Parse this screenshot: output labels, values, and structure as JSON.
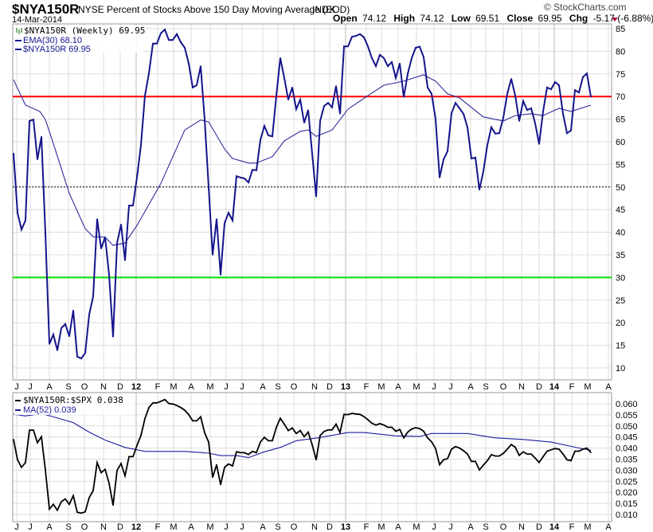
{
  "header": {
    "symbol": "$NYA150R",
    "description": "NYSE Percent of Stocks Above 150 Day Moving Average (EOD)",
    "exchange": "INDX",
    "date": "14-Mar-2014",
    "copyright": "© StockCharts.com",
    "open_label": "Open",
    "open": "74.12",
    "high_label": "High",
    "high": "74.12",
    "low_label": "Low",
    "low": "69.51",
    "close_label": "Close",
    "close": "69.95",
    "chg_label": "Chg",
    "chg": "-5.17 (-6.88%)",
    "chg_icon": "down-triangle-icon"
  },
  "colors": {
    "price": "#14148c",
    "ema": "#2b2b9a",
    "up": "#006400",
    "down": "#dc143c",
    "red_line": "#ff0000",
    "green_line": "#00e000",
    "ratio": "#000000",
    "ma": "#1c1ca0",
    "grid": "#dcdcdc"
  },
  "chart_data": [
    {
      "type": "line",
      "title": "$NYA150R (Weekly) 69.95",
      "x_unit": "week index (0 = mid-Jun 2011, 145 = 14-Mar-2014)",
      "ylim": [
        7.4,
        86
      ],
      "yticks": [
        "85",
        "80",
        "75",
        "70",
        "65",
        "60",
        "55",
        "50",
        "45",
        "40",
        "35",
        "30",
        "25",
        "20",
        "15",
        "10"
      ],
      "legend": [
        "$NYA150R (Weekly) 69.95",
        "EMA(30) 68.10",
        "$NYA150R 69.95"
      ],
      "reference_lines": [
        {
          "value": 70,
          "style": "red"
        },
        {
          "value": 50,
          "style": "dotted"
        },
        {
          "value": 30,
          "style": "green"
        }
      ],
      "series": [
        {
          "name": "$NYA150R",
          "values": [
            57.4,
            44.3,
            40.6,
            42.6,
            64.6,
            64.9,
            56.1,
            61.1,
            39.8,
            15.3,
            17.4,
            13.9,
            18.8,
            19.7,
            17.0,
            22.7,
            12.5,
            12.1,
            13.3,
            21.8,
            25.8,
            42.9,
            36.4,
            38.9,
            30.6,
            16.9,
            37.6,
            41.7,
            33.8,
            45.9,
            45.9,
            52.1,
            59.3,
            70.2,
            75.1,
            81.7,
            81.7,
            84.0,
            84.8,
            82.5,
            82.5,
            83.8,
            82.0,
            80.8,
            77.3,
            72.0,
            72.5,
            76.7,
            64.9,
            50,
            35.0,
            42.9,
            30.6,
            42.0,
            44.3,
            42.6,
            52.4,
            52.1,
            51.9,
            51.0,
            53.8,
            53.7,
            60.4,
            63.5,
            61.4,
            61.2,
            70.2,
            78.5,
            74.1,
            69.3,
            72.0,
            67.2,
            69.3,
            64.2,
            67.0,
            57.4,
            47.9,
            64.6,
            67.9,
            68.6,
            67.6,
            72.3,
            66.2,
            81.1,
            81.1,
            83.2,
            83.4,
            83.8,
            83.1,
            81.1,
            78.5,
            76.7,
            79.2,
            78.5,
            76.7,
            77.6,
            74.1,
            77.3,
            69.9,
            75.0,
            78.5,
            80.8,
            81.0,
            78.7,
            72.0,
            70.6,
            65.0,
            52.1,
            56.1,
            57.9,
            66.3,
            68.6,
            67.4,
            66.2,
            63.2,
            56.3,
            56.5,
            49.4,
            53.5,
            59.3,
            63.2,
            61.8,
            61.9,
            65.3,
            70.6,
            73.9,
            70.2,
            64.6,
            69.0,
            67.0,
            67.4,
            64.1,
            59.5,
            66.7,
            72.0,
            71.6,
            73.2,
            72.5,
            66.2,
            61.9,
            62.5,
            71.4,
            70.9,
            74.3,
            75.1,
            69.95
          ]
        },
        {
          "name": "EMA(30)",
          "points": [
            [
              0,
              73.7
            ],
            [
              3,
              68.1
            ],
            [
              6.6,
              66.7
            ],
            [
              8,
              64.9
            ],
            [
              10,
              59.6
            ],
            [
              14,
              48.6
            ],
            [
              18,
              40.8
            ],
            [
              20,
              39.0
            ],
            [
              23,
              38.9
            ],
            [
              25,
              37.1
            ],
            [
              28,
              37.6
            ],
            [
              31,
              41.5
            ],
            [
              37,
              50.8
            ],
            [
              43,
              62.6
            ],
            [
              47,
              64.8
            ],
            [
              49,
              64.4
            ],
            [
              53,
              58.4
            ],
            [
              55,
              56.3
            ],
            [
              59,
              55.3
            ],
            [
              61,
              55.3
            ],
            [
              65,
              56.7
            ],
            [
              68,
              60.2
            ],
            [
              72,
              62.3
            ],
            [
              74,
              62.6
            ],
            [
              76,
              61.2
            ],
            [
              80,
              62.6
            ],
            [
              84,
              67.2
            ],
            [
              89,
              70.2
            ],
            [
              93,
              72.5
            ],
            [
              98,
              73.4
            ],
            [
              103,
              74.8
            ],
            [
              106,
              73.4
            ],
            [
              109,
              70.6
            ],
            [
              112,
              69.7
            ],
            [
              118,
              65.5
            ],
            [
              123,
              64.6
            ],
            [
              126,
              65.8
            ],
            [
              130,
              66.2
            ],
            [
              133,
              65.8
            ],
            [
              137,
              67.4
            ],
            [
              140,
              66.7
            ],
            [
              145,
              68.1
            ]
          ]
        }
      ]
    },
    {
      "type": "line",
      "title": "$NYA150R:$SPX 0.038",
      "ylim": [
        0.0068,
        0.065
      ],
      "yticks": [
        "0.060",
        "0.055",
        "0.050",
        "0.045",
        "0.040",
        "0.035",
        "0.030",
        "0.025",
        "0.020",
        "0.015",
        "0.010"
      ],
      "legend": [
        "$NYA150R:$SPX 0.038",
        "MA(52) 0.039"
      ],
      "series": [
        {
          "name": "$NYA150R:$SPX",
          "values": [
            0.0439,
            0.0347,
            0.0313,
            0.0334,
            0.0481,
            0.0481,
            0.0424,
            0.0451,
            0.0301,
            0.0124,
            0.0146,
            0.0119,
            0.0158,
            0.017,
            0.0146,
            0.0185,
            0.011,
            0.0106,
            0.0112,
            0.0176,
            0.0208,
            0.0334,
            0.0289,
            0.0304,
            0.0241,
            0.0142,
            0.0299,
            0.033,
            0.0275,
            0.0361,
            0.0361,
            0.0412,
            0.0457,
            0.0533,
            0.0583,
            0.0604,
            0.0604,
            0.0611,
            0.0619,
            0.0601,
            0.0599,
            0.0592,
            0.0583,
            0.0571,
            0.0551,
            0.0523,
            0.0523,
            0.0541,
            0.0469,
            0.0427,
            0.0268,
            0.0325,
            0.0235,
            0.0313,
            0.0328,
            0.0319,
            0.0383,
            0.0379,
            0.0379,
            0.0371,
            0.0385,
            0.0379,
            0.0427,
            0.0449,
            0.0433,
            0.0433,
            0.0493,
            0.0535,
            0.0508,
            0.0479,
            0.0491,
            0.0466,
            0.0479,
            0.0451,
            0.0472,
            0.0415,
            0.0347,
            0.0457,
            0.0475,
            0.0482,
            0.0482,
            0.0508,
            0.047,
            0.0552,
            0.0551,
            0.0557,
            0.0554,
            0.0552,
            0.0542,
            0.0528,
            0.0512,
            0.0504,
            0.051,
            0.0504,
            0.0494,
            0.0494,
            0.0476,
            0.0484,
            0.0446,
            0.0472,
            0.0486,
            0.0492,
            0.0488,
            0.0476,
            0.0446,
            0.0428,
            0.0398,
            0.0325,
            0.0347,
            0.0352,
            0.0395,
            0.0407,
            0.04,
            0.0388,
            0.0373,
            0.034,
            0.034,
            0.0301,
            0.0323,
            0.0343,
            0.037,
            0.0364,
            0.0364,
            0.0376,
            0.0395,
            0.0416,
            0.0404,
            0.0367,
            0.0383,
            0.0373,
            0.0373,
            0.0355,
            0.0335,
            0.0361,
            0.0386,
            0.0392,
            0.0398,
            0.0395,
            0.0373,
            0.0347,
            0.0343,
            0.0386,
            0.0386,
            0.0395,
            0.04,
            0.038
          ]
        },
        {
          "name": "MA(52)",
          "points": [
            [
              0,
              0.0553
            ],
            [
              3,
              0.0545
            ],
            [
              7,
              0.0556
            ],
            [
              10,
              0.0541
            ],
            [
              15,
              0.0515
            ],
            [
              19,
              0.0472
            ],
            [
              23,
              0.0436
            ],
            [
              28,
              0.0403
            ],
            [
              33,
              0.0385
            ],
            [
              43,
              0.0385
            ],
            [
              49,
              0.0377
            ],
            [
              52,
              0.0366
            ],
            [
              56,
              0.0366
            ],
            [
              59,
              0.0357
            ],
            [
              63,
              0.0383
            ],
            [
              67,
              0.0403
            ],
            [
              71,
              0.0433
            ],
            [
              76,
              0.0445
            ],
            [
              77,
              0.0448
            ],
            [
              84,
              0.047
            ],
            [
              88,
              0.047
            ],
            [
              96,
              0.0455
            ],
            [
              102,
              0.0452
            ],
            [
              105,
              0.0466
            ],
            [
              114,
              0.0466
            ],
            [
              121,
              0.0446
            ],
            [
              128,
              0.0439
            ],
            [
              135,
              0.0427
            ],
            [
              141,
              0.0404
            ],
            [
              145,
              0.039
            ]
          ]
        }
      ]
    }
  ],
  "months": [
    {
      "label": "J",
      "w": 0.8
    },
    {
      "label": "J",
      "w": 4.2
    },
    {
      "label": "A",
      "w": 9
    },
    {
      "label": "S",
      "w": 13.8
    },
    {
      "label": "O",
      "w": 17.8
    },
    {
      "label": "N",
      "w": 22.6
    },
    {
      "label": "D",
      "w": 26.8
    },
    {
      "label": "12",
      "w": 30.8,
      "year": true
    },
    {
      "label": "F",
      "w": 36.2
    },
    {
      "label": "M",
      "w": 40.2
    },
    {
      "label": "A",
      "w": 44.6
    },
    {
      "label": "M",
      "w": 49.4
    },
    {
      "label": "J",
      "w": 53.4
    },
    {
      "label": "J",
      "w": 57.4
    },
    {
      "label": "A",
      "w": 62.6
    },
    {
      "label": "S",
      "w": 66.4
    },
    {
      "label": "O",
      "w": 70.4
    },
    {
      "label": "N",
      "w": 75.6
    },
    {
      "label": "D",
      "w": 79.4
    },
    {
      "label": "13",
      "w": 83.4,
      "year": true
    },
    {
      "label": "F",
      "w": 88.6
    },
    {
      "label": "M",
      "w": 92.4
    },
    {
      "label": "A",
      "w": 96.6
    },
    {
      "label": "M",
      "w": 101.2
    },
    {
      "label": "J",
      "w": 105.6
    },
    {
      "label": "J",
      "w": 109.8
    },
    {
      "label": "A",
      "w": 114.8
    },
    {
      "label": "S",
      "w": 118.6
    },
    {
      "label": "O",
      "w": 123
    },
    {
      "label": "N",
      "w": 127.6
    },
    {
      "label": "D",
      "w": 132
    },
    {
      "label": "14",
      "w": 135.8,
      "year": true
    },
    {
      "label": "F",
      "w": 140.2
    },
    {
      "label": "M",
      "w": 144.2
    },
    {
      "label": "A",
      "w": 149.4
    }
  ]
}
